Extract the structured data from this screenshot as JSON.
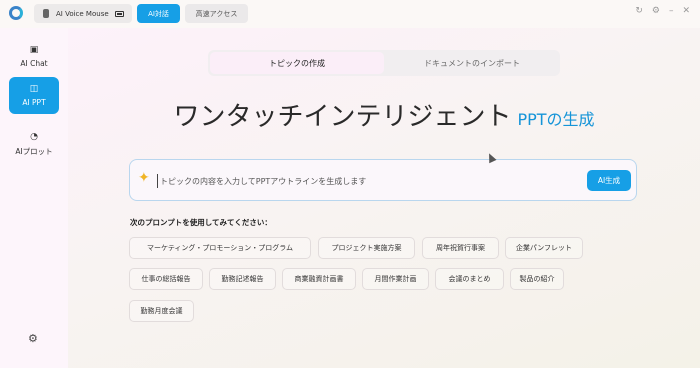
{
  "topbar": {
    "device_label": "AI Voice Mouse",
    "tabs": [
      {
        "label": "AI対話",
        "active": true
      },
      {
        "label": "高速アクセス",
        "active": false
      }
    ]
  },
  "sidebar": {
    "items": [
      {
        "label": "AI Chat",
        "icon": "chat-icon"
      },
      {
        "label": "AI PPT",
        "icon": "ppt-icon",
        "active": true
      },
      {
        "label": "AIプロット",
        "icon": "plot-icon"
      }
    ]
  },
  "main": {
    "mode_tabs": [
      {
        "label": "トピックの作成",
        "active": true
      },
      {
        "label": "ドキュメントのインポート",
        "active": false
      }
    ],
    "headline": "ワンタッチインテリジェント",
    "headline_accent": "PPTの生成",
    "prompt_placeholder": "トピックの内容を入力してPPTアウトラインを生成します",
    "generate_button": "AI生成",
    "suggest_title": "次のプロンプトを使用してみてください：",
    "chips": [
      "マーケティング・プロモーション・プログラム",
      "プロジェクト実施方案",
      "周年祝賀行事案",
      "企業パンフレット",
      "仕事の総括報告",
      "勤務記述報告",
      "商業融資計画書",
      "月間作業計画",
      "会議のまとめ",
      "製品の紹介",
      "勤務月度会議"
    ]
  },
  "colors": {
    "accent": "#169fe6",
    "headline_accent": "#1594d8"
  }
}
